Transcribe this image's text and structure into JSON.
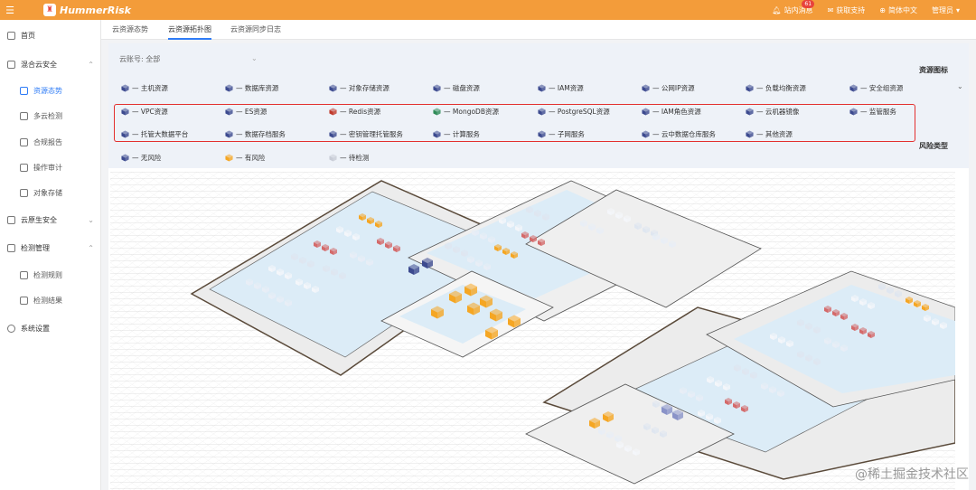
{
  "header": {
    "brand": "HummerRisk",
    "messages_label": "站内消息",
    "messages_count": "61",
    "support_label": "获取支持",
    "language_label": "简体中文",
    "user_label": "管理员"
  },
  "sidebar": {
    "items": [
      {
        "label": "首页"
      },
      {
        "label": "混合云安全"
      },
      {
        "label": "资源态势"
      },
      {
        "label": "多云检测"
      },
      {
        "label": "合规报告"
      },
      {
        "label": "操作审计"
      },
      {
        "label": "对象存储"
      },
      {
        "label": "云原生安全"
      },
      {
        "label": "检测管理"
      },
      {
        "label": "检测规则"
      },
      {
        "label": "检测结果"
      },
      {
        "label": "系统设置"
      }
    ]
  },
  "tabs": [
    {
      "label": "云资源态势"
    },
    {
      "label": "云资源拓扑图"
    },
    {
      "label": "云资源同步日志"
    }
  ],
  "filters": {
    "account_label": "云账号: 全部",
    "resource_icon_title": "资源图标",
    "risk_type_title": "风险类型"
  },
  "resource_legend": [
    {
      "label": "— 主机资源",
      "color": "#3c4a8f"
    },
    {
      "label": "— 数据库资源",
      "color": "#3c4a8f"
    },
    {
      "label": "— 对象存储资源",
      "color": "#3c4a8f"
    },
    {
      "label": "— 磁盘资源",
      "color": "#3c4a8f"
    },
    {
      "label": "— IAM资源",
      "color": "#3c4a8f"
    },
    {
      "label": "— 公网IP资源",
      "color": "#3c4a8f"
    },
    {
      "label": "— 负载均衡资源",
      "color": "#3c4a8f"
    },
    {
      "label": "— 安全组资源",
      "color": "#3c4a8f"
    },
    {
      "label": "— VPC资源",
      "color": "#3c4a8f"
    },
    {
      "label": "— ES资源",
      "color": "#3c4a8f"
    },
    {
      "label": "— Redis资源",
      "color": "#c0392b"
    },
    {
      "label": "— MongoDB资源",
      "color": "#2e8b57"
    },
    {
      "label": "— PostgreSQL资源",
      "color": "#3c4a8f"
    },
    {
      "label": "— IAM角色资源",
      "color": "#3c4a8f"
    },
    {
      "label": "— 云机器镜像",
      "color": "#3c4a8f"
    },
    {
      "label": "— 监管服务",
      "color": "#3c4a8f"
    },
    {
      "label": "— 托管大数据平台",
      "color": "#3c4a8f"
    },
    {
      "label": "— 数据存档服务",
      "color": "#3c4a8f"
    },
    {
      "label": "— 密钥管理托管服务",
      "color": "#3c4a8f"
    },
    {
      "label": "— 计算服务",
      "color": "#3c4a8f"
    },
    {
      "label": "— 子网服务",
      "color": "#3c4a8f"
    },
    {
      "label": "— 云中数据仓库服务",
      "color": "#3c4a8f"
    },
    {
      "label": "— 其他资源",
      "color": "#3c4a8f"
    }
  ],
  "risk_legend": [
    {
      "label": "— 无风险",
      "color": "#3c4a8f"
    },
    {
      "label": "— 有风险",
      "color": "#f5a623"
    },
    {
      "label": "— 待检测",
      "color": "#c8ccd6"
    }
  ],
  "watermark": "@稀土掘金技术社区"
}
